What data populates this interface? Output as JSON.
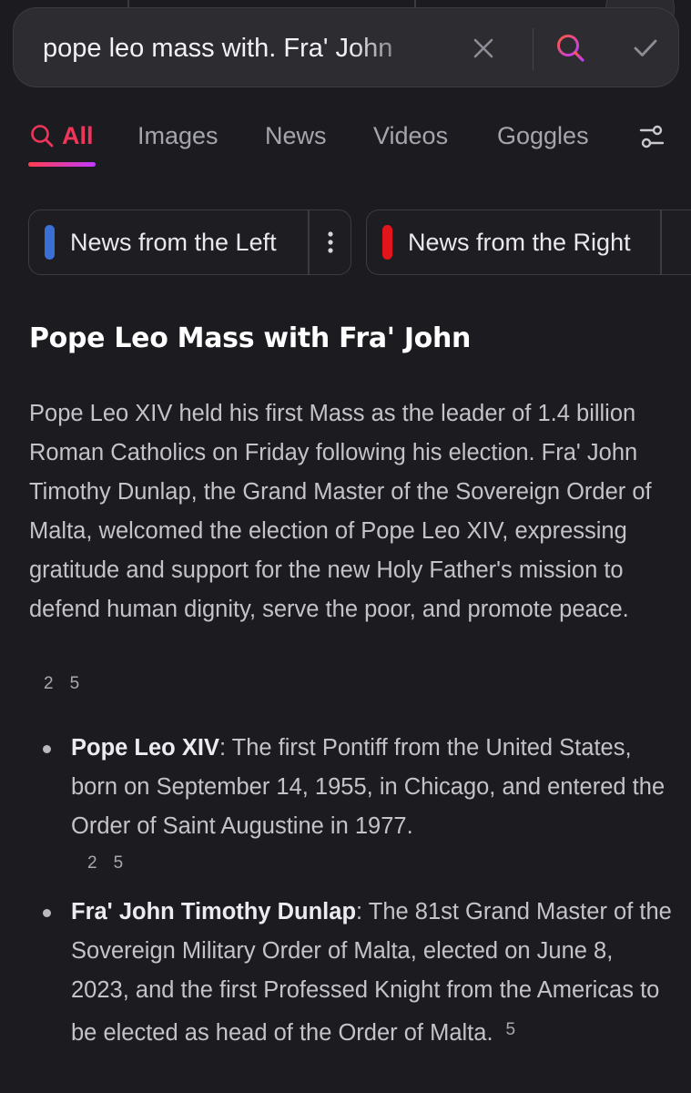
{
  "search": {
    "query": "pope leo mass with. Fra' John",
    "icons": {
      "clear": "close-icon",
      "search": "search-icon",
      "submit": "check-icon"
    }
  },
  "tabs": [
    {
      "label": "All",
      "active": true,
      "icon": "search-icon"
    },
    {
      "label": "Images"
    },
    {
      "label": "News"
    },
    {
      "label": "Videos"
    },
    {
      "label": "Goggles"
    }
  ],
  "goggles": {
    "left": {
      "label": "News from the Left",
      "color": "#3a6fd6"
    },
    "right": {
      "label": "News from the Right",
      "color": "#e0161c"
    }
  },
  "colors": {
    "accent": "#f0355a",
    "background": "#1c1c20"
  },
  "answer": {
    "title": "Pope Leo Mass with Fra' John",
    "summary": "Pope Leo XIV held his first Mass as the leader of 1.4 billion Roman Catholics on Friday following his election. Fra' John Timothy Dunlap, the Grand Master of the Sovereign Order of Malta, welcomed the election of Pope Leo XIV, expressing gratitude and support for the new Holy Father's mission to defend human dignity, serve the poor, and promote peace.",
    "summary_citations": [
      "2",
      "5"
    ],
    "bullets": [
      {
        "term": "Pope Leo XIV",
        "text": ": The first Pontiff from the United States, born on September 14, 1955, in Chicago, and entered the Order of Saint Augustine in 1977.",
        "citations": [
          "2",
          "5"
        ]
      },
      {
        "term": "Fra' John Timothy Dunlap",
        "text": ": The 81st Grand Master of the Sovereign Military Order of Malta, elected on June 8, 2023, and the first Professed Knight from the Americas to be elected as head of the Order of Malta.",
        "citations": [
          "5"
        ]
      }
    ]
  }
}
